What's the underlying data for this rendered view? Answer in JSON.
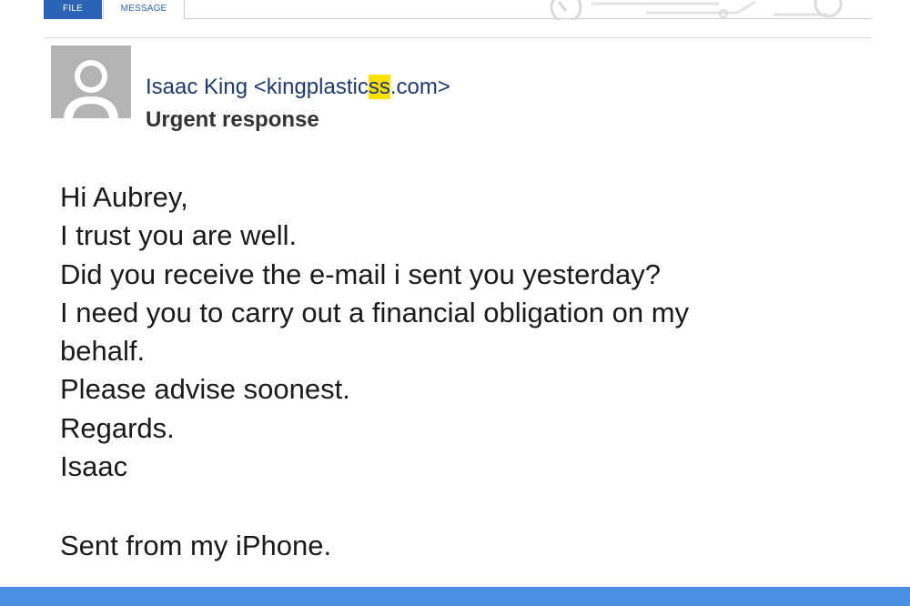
{
  "ribbon": {
    "tabs": [
      {
        "label": "FILE",
        "active": false
      },
      {
        "label": "MESSAGE",
        "active": true
      }
    ]
  },
  "message": {
    "sender_name": "Isaac King",
    "sender_email_prefix": "<kingplastic",
    "sender_email_highlight": "ss",
    "sender_email_suffix": ".com>",
    "subject": "Urgent response",
    "body_lines": [
      "Hi Aubrey,",
      "I trust you are well.",
      "Did you receive the e-mail i sent you yesterday?",
      "I need you to carry out a financial obligation on my",
      "behalf.",
      "Please advise soonest.",
      "Regards.",
      "Isaac"
    ],
    "signature": "Sent from my iPhone."
  },
  "colors": {
    "accent": "#2b63b6",
    "highlight": "#ffe000",
    "bottom_bar": "#4a90e2",
    "sender_text": "#1f3a6e"
  }
}
